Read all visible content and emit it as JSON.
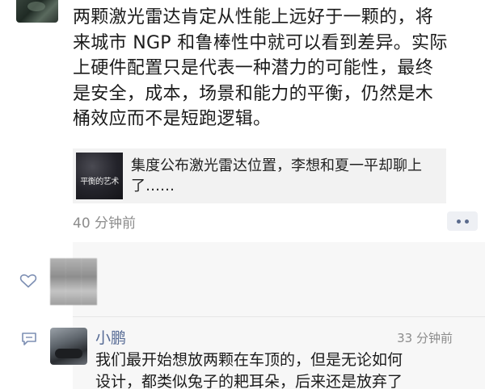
{
  "post": {
    "lines": [
      "两颗激光雷达肯定从性能上远好于一颗的，将",
      "来城市 NGP 和鲁棒性中就可以看到差异。实际",
      "上硬件配置只是代表一种潜力的可能性，最终",
      "是安全，成本，场景和能力的平衡，仍然是木",
      "桶效应而不是短跑逻辑。"
    ],
    "time": "40 分钟前"
  },
  "link_card": {
    "thumb_text": "平衡的艺术",
    "title": "集度公布激光雷达位置，李想和夏一平却聊上了……"
  },
  "likes": {
    "icon": "heart-outline-icon"
  },
  "comment": {
    "icon": "comment-bubble-icon",
    "author": "小鹏",
    "time": "33 分钟前",
    "lines": [
      "我们最开始想放两颗在车顶的，但是无论如何",
      "设计，都类似兔子的耙耳朵，后来还是放弃了"
    ]
  },
  "colors": {
    "name_link": "#576b95",
    "muted": "#8c8c8c",
    "panel": "#f7f7f7"
  }
}
